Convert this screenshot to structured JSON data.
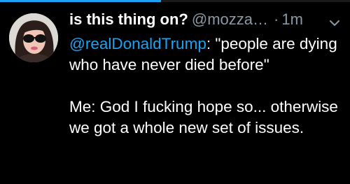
{
  "progress": 0.46,
  "tweet": {
    "display_name": "is this thing on?",
    "handle": "@mozza…",
    "separator": "·",
    "time": "1m",
    "mention": "@realDonaldTrump",
    "line1_rest": ": \"people are dying who have never died before\"",
    "line2": "Me: God I fucking hope so... otherwise we got a whole new set of issues."
  },
  "icons": {
    "avatar": "avatar-photo",
    "caret": "chevron-down-icon"
  },
  "colors": {
    "background": "#000000",
    "text": "#ffffff",
    "secondary": "#8b98a5",
    "accent": "#1da1f2"
  }
}
